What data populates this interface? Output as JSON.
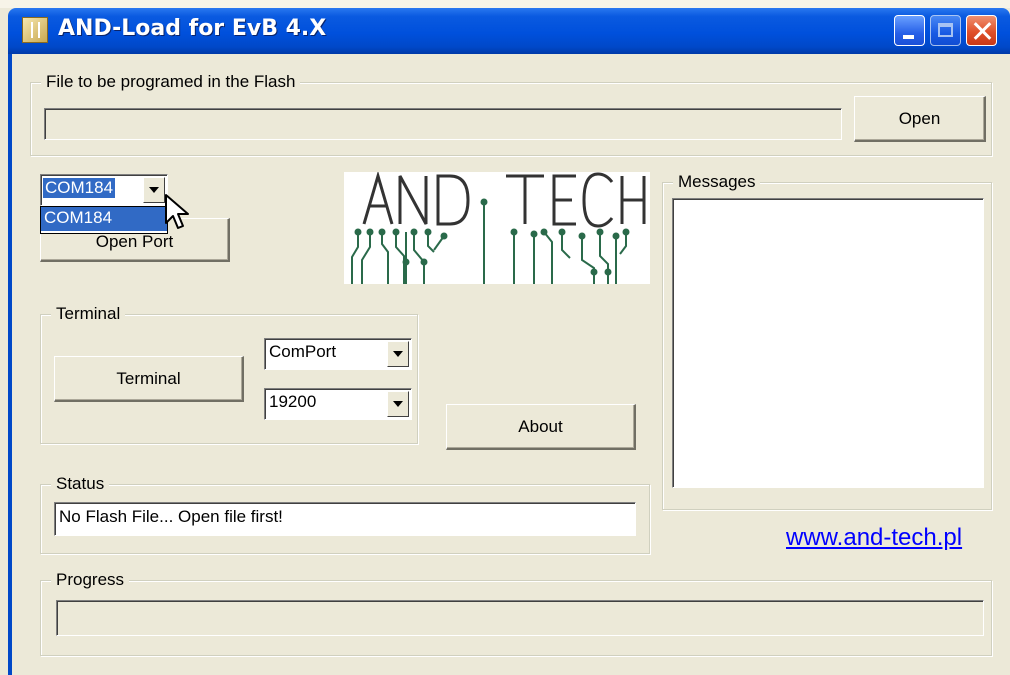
{
  "window": {
    "title": "AND-Load for EvB 4.X"
  },
  "flash_file": {
    "legend": "File to be programed in the Flash",
    "path_value": "",
    "open_label": "Open"
  },
  "port": {
    "selected": "COM184",
    "dropdown_options": [
      "COM184"
    ],
    "open_port_label": "Open Port"
  },
  "logo": {
    "text": "AND . TECH"
  },
  "terminal": {
    "legend": "Terminal",
    "button_label": "Terminal",
    "port_select": "ComPort",
    "baud_select": "19200"
  },
  "about_label": "About",
  "status": {
    "legend": "Status",
    "text": "No Flash File...  Open file first!"
  },
  "messages": {
    "legend": "Messages"
  },
  "url": "www.and-tech.pl",
  "progress": {
    "legend": "Progress",
    "value_percent": 0
  },
  "colors": {
    "titlebar": "#0050dc",
    "face": "#ece9d8",
    "selection": "#316ac5",
    "link": "#0000ff",
    "logo_dark": "#333333",
    "logo_circuit": "#2a6a4a"
  }
}
